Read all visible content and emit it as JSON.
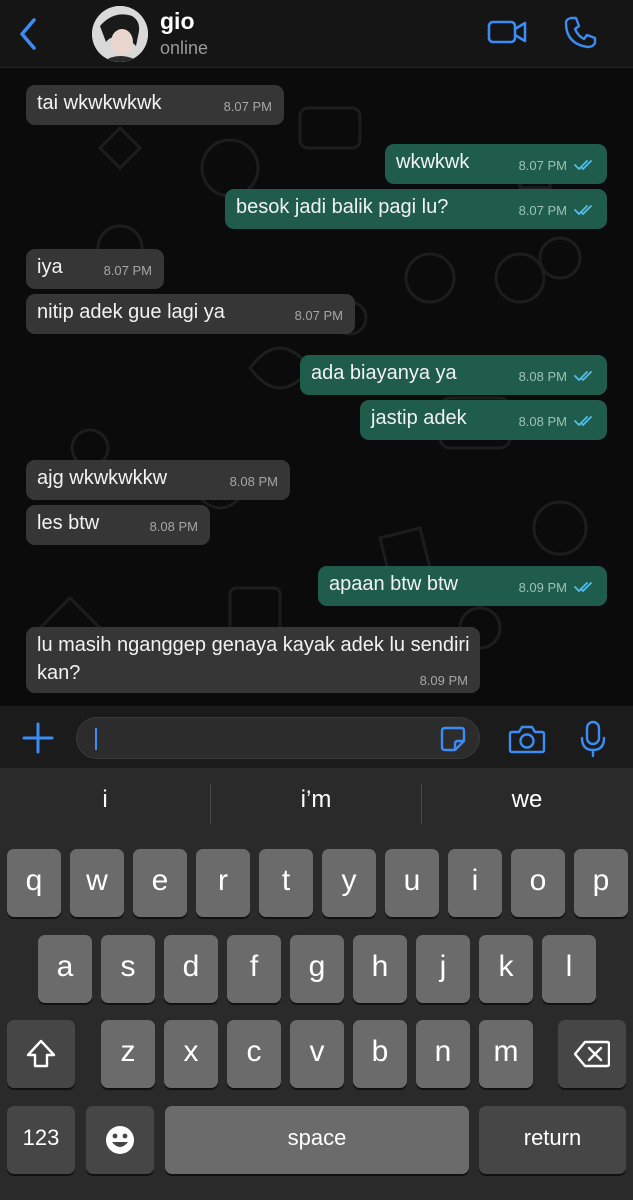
{
  "colors": {
    "accent": "#3b8cf5",
    "incoming_bubble": "#363636",
    "outgoing_bubble": "#1f5c4b",
    "read_ticks": "#53bdeb"
  },
  "header": {
    "back_icon": "chevron-left-icon",
    "contact_name": "gio",
    "status": "online",
    "video_icon": "video-camera-icon",
    "call_icon": "phone-icon"
  },
  "messages": [
    {
      "direction": "in",
      "text": "tai wkwkwkwk",
      "time": "8.07 PM"
    },
    {
      "direction": "out",
      "text": "wkwkwk",
      "time": "8.07 PM",
      "read": true
    },
    {
      "direction": "out",
      "text": "besok jadi balik pagi lu?",
      "time": "8.07 PM",
      "read": true
    },
    {
      "direction": "in",
      "text": "iya",
      "time": "8.07 PM"
    },
    {
      "direction": "in",
      "text": "nitip adek gue lagi ya",
      "time": "8.07 PM"
    },
    {
      "direction": "out",
      "text": "ada biayanya ya",
      "time": "8.08 PM",
      "read": true
    },
    {
      "direction": "out",
      "text": "jastip adek",
      "time": "8.08 PM",
      "read": true
    },
    {
      "direction": "in",
      "text": "ajg wkwkwkkw",
      "time": "8.08 PM"
    },
    {
      "direction": "in",
      "text": "les btw",
      "time": "8.08 PM"
    },
    {
      "direction": "out",
      "text": "apaan btw btw",
      "time": "8.09 PM",
      "read": true
    },
    {
      "direction": "in",
      "text": "lu masih nganggep genaya kayak adek lu sendiri kan?",
      "time": "8.09 PM"
    }
  ],
  "input_bar": {
    "plus_icon": "plus-icon",
    "input_value": "",
    "sticker_icon": "sticker-icon",
    "camera_icon": "camera-icon",
    "mic_icon": "microphone-icon"
  },
  "keyboard": {
    "suggestions": [
      "i",
      "i’m",
      "we"
    ],
    "row1": [
      "q",
      "w",
      "e",
      "r",
      "t",
      "y",
      "u",
      "i",
      "o",
      "p"
    ],
    "row2": [
      "a",
      "s",
      "d",
      "f",
      "g",
      "h",
      "j",
      "k",
      "l"
    ],
    "row3": [
      "z",
      "x",
      "c",
      "v",
      "b",
      "n",
      "m"
    ],
    "shift_icon": "shift-icon",
    "delete_icon": "backspace-icon",
    "numbers_label": "123",
    "emoji_icon": "emoji-icon",
    "space_label": "space",
    "return_label": "return"
  }
}
